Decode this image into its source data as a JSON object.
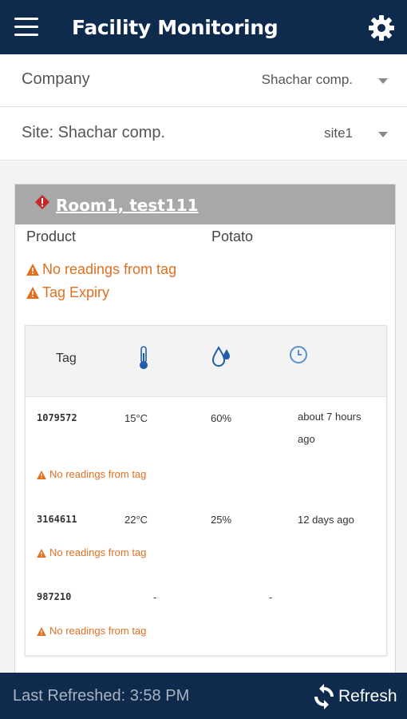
{
  "app_bar": {
    "title": "Facility Monitoring",
    "menu_icon": "hamburger-menu-icon",
    "settings_icon": "gear-icon",
    "color": "#0e2a4d"
  },
  "filters": {
    "company": {
      "label": "Company",
      "value": "Shachar comp."
    },
    "site": {
      "label": "Site: Shachar comp.",
      "value": "site1"
    }
  },
  "room": {
    "title": "Room1, test111",
    "alert_icon": "alert-diamond-icon",
    "product_label": "Product",
    "product_value": "Potato",
    "warnings": [
      "No readings from tag",
      "Tag Expiry"
    ],
    "warning_color": "#e07020"
  },
  "table": {
    "header_tag": "Tag",
    "header_icons": [
      "thermometer-icon",
      "humidity-drop-icon",
      "clock-icon"
    ],
    "rows": [
      {
        "tag": "1079572",
        "temp": "15°C",
        "humidity": "60%",
        "age": "about 7 hours ago",
        "warning": "No readings from tag"
      },
      {
        "tag": "3164611",
        "temp": "22°C",
        "humidity": "25%",
        "age": "12 days ago",
        "warning": "No readings from tag"
      },
      {
        "tag": "987210",
        "temp": "-",
        "humidity": "-",
        "age": "",
        "warning": "No readings from tag"
      }
    ]
  },
  "footer": {
    "last_refreshed": "Last Refreshed: 3:58 PM",
    "refresh_label": "Refresh",
    "refresh_icon": "refresh-icon"
  }
}
